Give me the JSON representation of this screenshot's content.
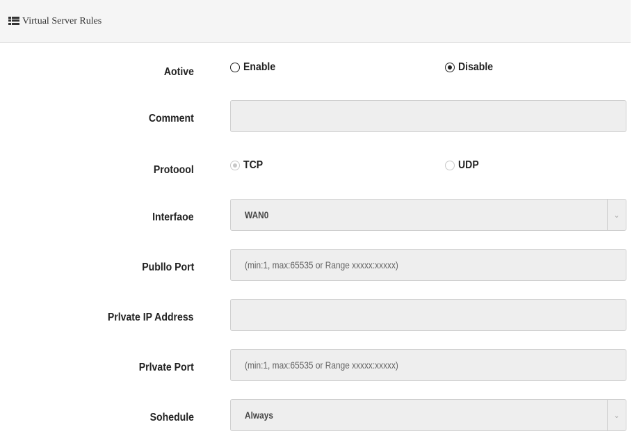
{
  "panel": {
    "title": "Virtual Server Rules",
    "icon": "list-icon"
  },
  "form": {
    "active": {
      "label": "Aotive",
      "options": [
        {
          "label": "Enable",
          "checked": false
        },
        {
          "label": "Disable",
          "checked": true
        }
      ]
    },
    "comment": {
      "label": "Comment",
      "value": ""
    },
    "protocol": {
      "label": "Protoool",
      "options": [
        {
          "label": "TCP",
          "checked": true,
          "disabled": true
        },
        {
          "label": "UDP",
          "checked": false,
          "disabled": true
        }
      ]
    },
    "interface": {
      "label": "Interfaoe",
      "selected": "WAN0"
    },
    "public_port": {
      "label": "Publlo Port",
      "placeholder": "(min:1, max:65535 or Range xxxxx:xxxxx)"
    },
    "private_ip": {
      "label": "Prlvate IP Address",
      "value": ""
    },
    "private_port": {
      "label": "Prlvate Port",
      "placeholder": "(min:1, max:65535 or Range xxxxx:xxxxx)"
    },
    "schedule": {
      "label": "Sohedule",
      "selected": "Always"
    }
  }
}
